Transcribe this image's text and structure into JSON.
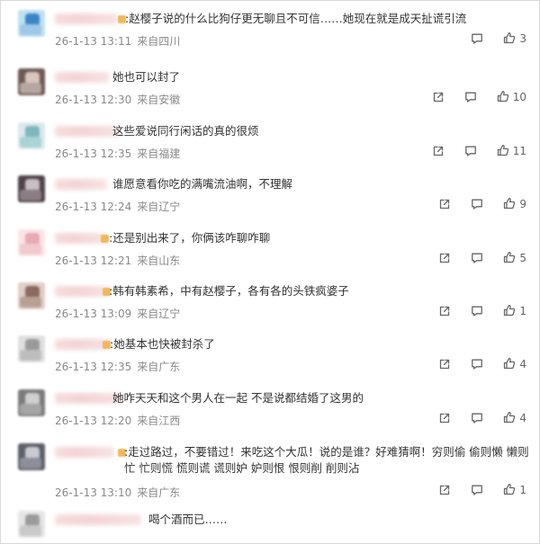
{
  "comments": [
    {
      "text": ":赵樱子说的什么比狗仔更无聊且不可信……她现在就是成天扯谎引流",
      "time": "26-1-13 13:11",
      "location": "来自四川",
      "likes": "3",
      "has_reply": true,
      "has_share": false
    },
    {
      "text": "她也可以封了",
      "time": "26-1-13 12:30",
      "location": "来自安徽",
      "likes": "10",
      "has_reply": true,
      "has_share": true
    },
    {
      "text": "这些爱说同行闲话的真的很烦",
      "time": "26-1-13 12:35",
      "location": "来自福建",
      "likes": "11",
      "has_reply": true,
      "has_share": true
    },
    {
      "text": "谁愿意看你吃的满嘴流油啊，不理解",
      "time": "26-1-13 12:24",
      "location": "来自辽宁",
      "likes": "9",
      "has_reply": true,
      "has_share": true
    },
    {
      "text": ":还是别出来了，你俩该咋聊咋聊",
      "time": "26-1-13 12:21",
      "location": "来自山东",
      "likes": "5",
      "has_reply": true,
      "has_share": true
    },
    {
      "text": ":韩有韩素希，中有赵樱子，各有各的头铁疯婆子",
      "time": "26-1-13 13:09",
      "location": "来自辽宁",
      "likes": "1",
      "has_reply": true,
      "has_share": true
    },
    {
      "text": ":她基本也快被封杀了",
      "time": "26-1-13 12:35",
      "location": "来自广东",
      "likes": "4",
      "has_reply": true,
      "has_share": true
    },
    {
      "text": "她咋天天和这个男人在一起 不是说都结婚了这男的",
      "time": "26-1-13 12:20",
      "location": "来自江西",
      "likes": "4",
      "has_reply": true,
      "has_share": true
    },
    {
      "text": ":走过路过，不要错过！来吃这个大瓜！说的是谁？好难猜啊！穷则偷 偷则懒 懒则忙 忙则慌 慌则谎 谎则妒 妒则恨 恨则削 削则沾",
      "time": "26-1-13 13:10",
      "location": "来自广东",
      "likes": "1",
      "has_reply": true,
      "has_share": true
    },
    {
      "text": "喝个酒而已……",
      "time": "",
      "location": "",
      "likes": "",
      "has_reply": false,
      "has_share": false
    }
  ],
  "icons": {
    "reply": "comment-icon",
    "share": "share-icon",
    "like": "thumbs-up-icon"
  },
  "colors": {
    "text": "#333333",
    "meta": "#8a8a8a",
    "icon": "#666666",
    "name_blur": "#f3d3d6",
    "badge": "#f0b85b"
  }
}
